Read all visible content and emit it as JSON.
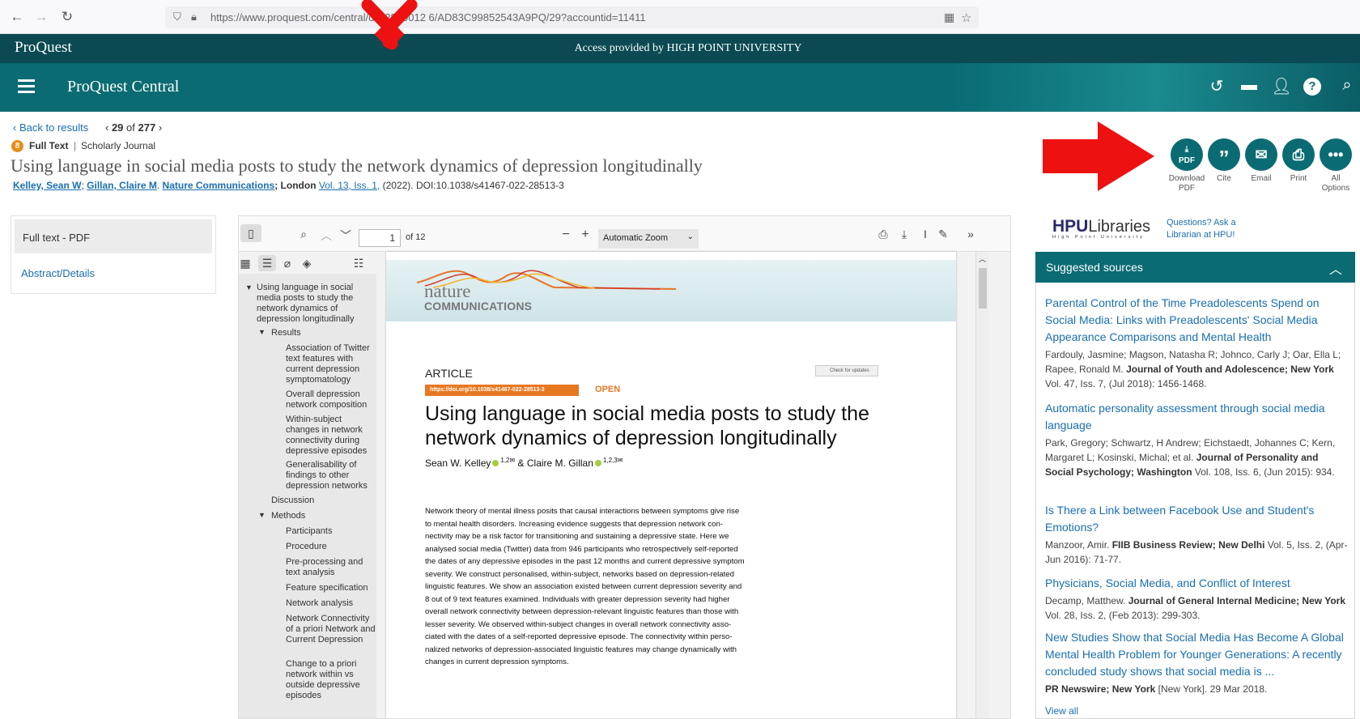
{
  "browser": {
    "url": "https://www.proquest.com/central/d…2890012 6/AD83C99852543A9PQ/29?accountid=11411"
  },
  "topbar": {
    "logo": "ProQuest",
    "access": "Access provided by HIGH POINT UNIVERSITY"
  },
  "header": {
    "title": "ProQuest Central"
  },
  "nav": {
    "back": "‹ Back to results",
    "counter_prefix": "‹ ",
    "counter_current": "29",
    "counter_of": " of ",
    "counter_total": "277",
    "counter_suffix": " ›"
  },
  "doc": {
    "badge": "8",
    "fulltext": "Full Text",
    "sep": "|",
    "type": "Scholarly Journal",
    "title": "Using language in social media posts to study the network dynamics of depression longitudinally",
    "author1": "Kelley, Sean W",
    "author2": "Gillan, Claire M",
    "journal": "Nature Communications",
    "place": "; London",
    "vol": "Vol. 13, Iss. 1,",
    "rest": "(2022). DOI:10.1038/s41467-022-28513-3"
  },
  "actions": [
    {
      "icon": "download-pdf-icon",
      "label": "Download PDF"
    },
    {
      "icon": "cite-icon",
      "label": "Cite"
    },
    {
      "icon": "email-icon",
      "label": "Email"
    },
    {
      "icon": "print-icon",
      "label": "Print"
    },
    {
      "icon": "more-icon",
      "label": "All Options"
    }
  ],
  "leftnav": {
    "pdf": "Full text - PDF",
    "abstract": "Abstract/Details"
  },
  "viewer": {
    "page": "1",
    "of": "of 12",
    "zoom": "Automatic Zoom",
    "outline": [
      "Using language in social media posts to study the network dynamics of depression longitudinally",
      "Results",
      "Association of Twitter text features with current depression symptomatology",
      "Overall depression network composition",
      "Within-subject changes in network connectivity during depressive episodes",
      "Generalisability of findings to other depression networks",
      "Discussion",
      "Methods",
      "Participants",
      "Procedure",
      "Pre-processing and text analysis",
      "Feature specification",
      "Network analysis",
      "Network Connectivity of a priori Network and Current Depression",
      "Change to a priori network within vs outside depressive episodes"
    ]
  },
  "pdfpage": {
    "brand1": "nature",
    "brand2": "COMMUNICATIONS",
    "article": "ARTICLE",
    "check": "Check for updates",
    "doi": "https://doi.org/10.1038/s41467-022-28513-3",
    "open": "OPEN",
    "title1": "Using language in social media posts to study the",
    "title2": "network dynamics of depression longitudinally",
    "authors": "Sean W. Kelley",
    "authors_sup1": "1,2✉",
    "authors_mid": " & Claire M. Gillan",
    "authors_sup2": "1,2,3✉",
    "abstract": [
      "Network theory of mental illness posits that causal interactions between symptoms give rise",
      "to mental health disorders. Increasing evidence suggests that depression network con-",
      "nectivity may be a risk factor for transitioning and sustaining a depressive state. Here we",
      "analysed social media (Twitter) data from 946 participants who retrospectively self-reported",
      "the dates of any depressive episodes in the past 12 months and current depressive symptom",
      "severity. We construct personalised, within-subject, networks based on depression-related",
      "linguistic features. We show an association existed between current depression severity and",
      "8 out of 9 text features examined. Individuals with greater depression severity had higher",
      "overall network connectivity between depression-relevant linguistic features than those with",
      "lesser severity. We observed within-subject changes in overall network connectivity asso-",
      "ciated with the dates of a self-reported depressive episode. The connectivity within perso-",
      "nalized networks of depression-associated linguistic features may change dynamically with",
      "changes in current depression symptoms."
    ]
  },
  "hpu": {
    "logo_hpu": "HPU",
    "logo_lib": "Libraries",
    "logo_sub": "High Point University",
    "q1": "Questions? Ask a",
    "q2": "Librarian at HPU!"
  },
  "suggested": {
    "heading": "Suggested sources",
    "items": [
      {
        "title": "Parental Control of the Time Preadolescents Spend on Social Media: Links with Preadolescents' Social Media Appearance Comparisons and Mental Health",
        "authors": "Fardouly, Jasmine; Magson, Natasha R; Johnco, Carly J; Oar, Ella L; Rapee, Ronald M.",
        "journal": "Journal of Youth and Adolescence; New York",
        "info": " Vol. 47, Iss. 7,  (Jul 2018): 1456-1468."
      },
      {
        "title": "Automatic personality assessment through social media language",
        "authors": "Park, Gregory; Schwartz, H Andrew; Eichstaedt, Johannes C; Kern, Margaret L; Kosinski, Michal; et al.",
        "journal": "Journal of Personality and Social Psychology; Washington",
        "info": " Vol. 108, Iss. 6,  (Jun 2015): 934."
      },
      {
        "title": "Is There a Link between Facebook Use and Student's Emotions?",
        "authors": "Manzoor, Amir.",
        "journal": "FIIB Business Review; New Delhi",
        "info": " Vol. 5, Iss. 2,  (Apr-Jun 2016): 71-77."
      },
      {
        "title": "Physicians, Social Media, and Conflict of Interest",
        "authors": "Decamp, Matthew.",
        "journal": "Journal of General Internal Medicine; New York",
        "info": " Vol. 28, Iss. 2,  (Feb 2013): 299-303."
      },
      {
        "title": "New Studies Show that Social Media Has Become A Global Mental Health Problem for Younger Generations: A recently concluded study shows that social media is ...",
        "authors": "",
        "journal": "PR Newswire; New York",
        "info": " [New York]. 29 Mar 2018."
      }
    ],
    "viewall": "View all"
  }
}
